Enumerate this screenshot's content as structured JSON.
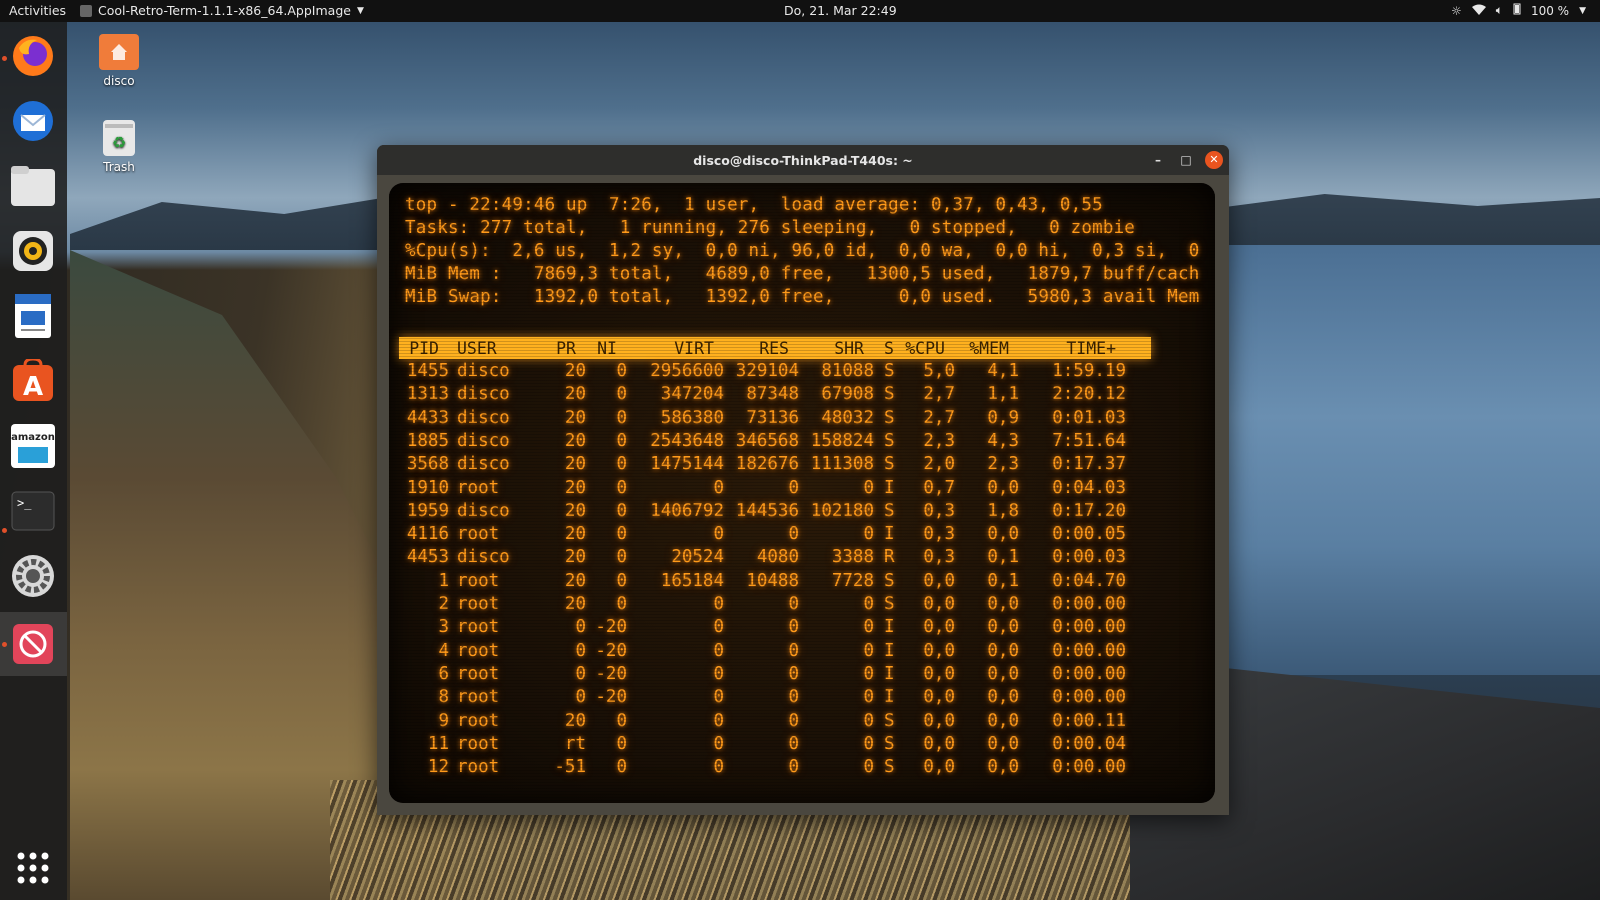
{
  "topbar": {
    "activities": "Activities",
    "app_name": "Cool-Retro-Term-1.1.1-x86_64.AppImage",
    "clock": "Do, 21. Mar  22:49",
    "battery": "100 %"
  },
  "dock": {
    "items": [
      "firefox-icon",
      "thunderbird-icon",
      "files-icon",
      "rhythmbox-icon",
      "writer-icon",
      "software-center-icon",
      "amazon-icon",
      "terminal-icon",
      "settings-icon",
      "blocked-app-icon",
      "app-grid-icon"
    ],
    "amazon_label": "amazon"
  },
  "desktop": {
    "home_label": "disco",
    "trash_label": "Trash"
  },
  "window": {
    "title": "disco@disco-ThinkPad-T440s: ~"
  },
  "summary": [
    "top - 22:49:46 up  7:26,  1 user,  load average: 0,37, 0,43, 0,55",
    "Tasks: 277 total,   1 running, 276 sleeping,   0 stopped,   0 zombie",
    "%Cpu(s):  2,6 us,  1,2 sy,  0,0 ni, 96,0 id,  0,0 wa,  0,0 hi,  0,3 si,  0",
    "MiB Mem :   7869,3 total,   4689,0 free,   1300,5 used,   1879,7 buff/cach",
    "MiB Swap:   1392,0 total,   1392,0 free,      0,0 used.   5980,3 avail Mem"
  ],
  "columns": [
    "PID",
    "USER",
    "PR",
    "NI",
    "VIRT",
    "RES",
    "SHR",
    "S",
    "%CPU",
    "%MEM",
    "TIME+"
  ],
  "processes": [
    [
      "1455",
      "disco",
      "20",
      "0",
      "2956600",
      "329104",
      "81088",
      "S",
      "5,0",
      "4,1",
      "1:59.19"
    ],
    [
      "1313",
      "disco",
      "20",
      "0",
      "347204",
      "87348",
      "67908",
      "S",
      "2,7",
      "1,1",
      "2:20.12"
    ],
    [
      "4433",
      "disco",
      "20",
      "0",
      "586380",
      "73136",
      "48032",
      "S",
      "2,7",
      "0,9",
      "0:01.03"
    ],
    [
      "1885",
      "disco",
      "20",
      "0",
      "2543648",
      "346568",
      "158824",
      "S",
      "2,3",
      "4,3",
      "7:51.64"
    ],
    [
      "3568",
      "disco",
      "20",
      "0",
      "1475144",
      "182676",
      "111308",
      "S",
      "2,0",
      "2,3",
      "0:17.37"
    ],
    [
      "1910",
      "root",
      "20",
      "0",
      "0",
      "0",
      "0",
      "I",
      "0,7",
      "0,0",
      "0:04.03"
    ],
    [
      "1959",
      "disco",
      "20",
      "0",
      "1406792",
      "144536",
      "102180",
      "S",
      "0,3",
      "1,8",
      "0:17.20"
    ],
    [
      "4116",
      "root",
      "20",
      "0",
      "0",
      "0",
      "0",
      "I",
      "0,3",
      "0,0",
      "0:00.05"
    ],
    [
      "4453",
      "disco",
      "20",
      "0",
      "20524",
      "4080",
      "3388",
      "R",
      "0,3",
      "0,1",
      "0:00.03"
    ],
    [
      "1",
      "root",
      "20",
      "0",
      "165184",
      "10488",
      "7728",
      "S",
      "0,0",
      "0,1",
      "0:04.70"
    ],
    [
      "2",
      "root",
      "20",
      "0",
      "0",
      "0",
      "0",
      "S",
      "0,0",
      "0,0",
      "0:00.00"
    ],
    [
      "3",
      "root",
      "0",
      "-20",
      "0",
      "0",
      "0",
      "I",
      "0,0",
      "0,0",
      "0:00.00"
    ],
    [
      "4",
      "root",
      "0",
      "-20",
      "0",
      "0",
      "0",
      "I",
      "0,0",
      "0,0",
      "0:00.00"
    ],
    [
      "6",
      "root",
      "0",
      "-20",
      "0",
      "0",
      "0",
      "I",
      "0,0",
      "0,0",
      "0:00.00"
    ],
    [
      "8",
      "root",
      "0",
      "-20",
      "0",
      "0",
      "0",
      "I",
      "0,0",
      "0,0",
      "0:00.00"
    ],
    [
      "9",
      "root",
      "20",
      "0",
      "0",
      "0",
      "0",
      "S",
      "0,0",
      "0,0",
      "0:00.11"
    ],
    [
      "11",
      "root",
      "rt",
      "0",
      "0",
      "0",
      "0",
      "S",
      "0,0",
      "0,0",
      "0:00.04"
    ],
    [
      "12",
      "root",
      "-51",
      "0",
      "0",
      "0",
      "0",
      "S",
      "0,0",
      "0,0",
      "0:00.00"
    ]
  ],
  "colors": {
    "phosphor": "#ff9a1a",
    "header_bar": "#ffb11f",
    "close_button": "#e9541f"
  }
}
